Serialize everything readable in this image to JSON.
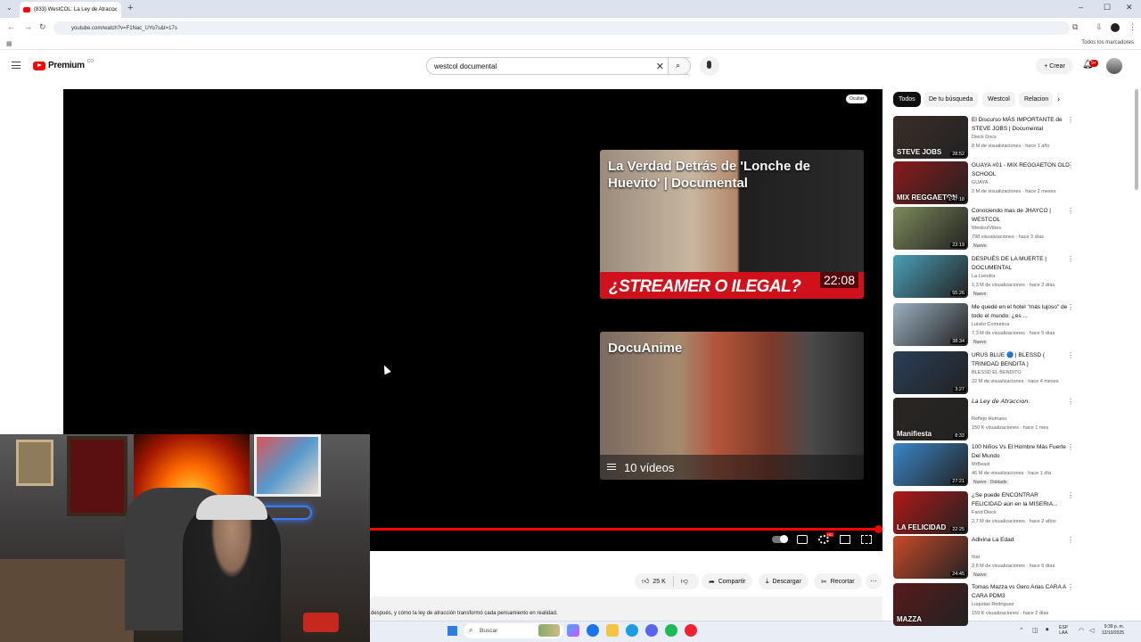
{
  "browser": {
    "tab_title": "(833) WestCOL: La Ley de Atracc",
    "url": "youtube.com/watch?v=F1Nac_UYo7s&t=17s",
    "bookmarks_folder": "Todos los marcadores"
  },
  "header": {
    "logo_word": "Premium",
    "logo_country": "CO",
    "search_value": "westcol documental",
    "create_label": "Crear",
    "notif_count": "9+"
  },
  "player": {
    "hide_label": "Ocultar",
    "progress": 0.995,
    "endcard1": {
      "title": "La Verdad Detrás de 'Lonche de Huevito' | Documental",
      "banner": "¿STREAMER O ILEGAL?",
      "duration": "22:08"
    },
    "endcard2": {
      "title": "DocuAnime",
      "count": "10 vídeos"
    }
  },
  "actions": {
    "likes": "25 K",
    "share": "Compartir",
    "download": "Descargar",
    "clip": "Recortar"
  },
  "description_snippet": "después, y cómo la ley de atracción transformó cada pensamiento en realidad.",
  "chips": [
    "Todos",
    "De tu búsqueda",
    "Westcol",
    "Relacion"
  ],
  "recommendations": [
    {
      "title": "El Discurso MÁS IMPORTANTE de STEVE JOBS | Documental",
      "channel": "Dieck Docs",
      "meta": "8 M de visualizaciones · hace 1 año",
      "duration": "28:52",
      "badge": "",
      "thumb_text": "STEVE JOBS",
      "color": "#3a2e28"
    },
    {
      "title": "GUAYA #01 - MIX REGGAETON OLD SCHOOL",
      "channel": "GUAYA",
      "meta": "2 M de visualizaciones · hace 2 meses",
      "duration": "1:47:18",
      "badge": "",
      "thumb_text": "MIX REGGAETON",
      "color": "#8a1a1a"
    },
    {
      "title": "Conociendo mas de JHAYCO | WESTCOL",
      "channel": "WestcolVibes",
      "meta": "798 visualizaciones · hace 3 días",
      "duration": "23:19",
      "badge": "Nuevo",
      "thumb_text": "",
      "color": "#7d8a5a"
    },
    {
      "title": "DESPUÉS DE LA MUERTE | DOCUMENTAL",
      "channel": "La Lìendra",
      "meta": "1,3 M de visualizaciones · hace 2 días",
      "duration": "55:26",
      "badge": "Nuevo",
      "thumb_text": "",
      "color": "#4aa0b8"
    },
    {
      "title": "Me quedé en el hotel \"más lujoso\" de todo el mundo: ¿es ...",
      "channel": "Luisito Comunica",
      "meta": "7,3 M de visualizaciones · hace 5 días",
      "duration": "38:34",
      "badge": "Nuevo",
      "thumb_text": "",
      "color": "#9ab0c0"
    },
    {
      "title": "URUS BLUE 🔵 | BLESSD ( TRINIDAD BENDITA )",
      "channel": "BLESSD EL BENDITO",
      "meta": "22 M de visualizaciones · hace 4 meses",
      "duration": "3:27",
      "badge": "",
      "thumb_text": "",
      "color": "#2a3e58"
    },
    {
      "title": "𝘓𝘢 𝘓𝘦𝘺 𝘥𝘦 𝘈𝘵𝘳𝘢𝘤𝘤𝘪𝘰𝘯.",
      "channel": "Reflejo Humano",
      "meta": "150 K visualizaciones · hace 1 mes",
      "duration": "8:33",
      "badge": "",
      "thumb_text": "Manifiesta",
      "color": "#2a2622"
    },
    {
      "title": "100 Niños Vs El Hombre Más Fuerte Del Mundo",
      "channel": "MrBeast",
      "meta": "46 M de visualizaciones · hace 1 día",
      "duration": "27:21",
      "badge": "Nuevo · Doblado",
      "thumb_text": "",
      "color": "#3a86c8"
    },
    {
      "title": "¿Se puede ENCONTRAR FELICIDAD aún en la MISERIA...",
      "channel": "Farid Dieck",
      "meta": "2,7 M de visualizaciones · hace 2 años",
      "duration": "22:25",
      "badge": "",
      "thumb_text": "LA FELICIDAD",
      "color": "#b01818"
    },
    {
      "title": "Adivina La Edad",
      "channel": "Ibai",
      "meta": "2,8 M de visualizaciones · hace 6 días",
      "duration": "24:45",
      "badge": "Nuevo",
      "thumb_text": "",
      "color": "#c84a2a"
    },
    {
      "title": "Tomas Mazza vs Gero Arias CARA A CARA PDM3",
      "channel": "Luquitas Rodriguez",
      "meta": "159 K visualizaciones · hace 2 días",
      "duration": "",
      "badge": "",
      "thumb_text": "MAZZA",
      "color": "#5a1a1a"
    }
  ],
  "taskbar": {
    "search_placeholder": "Buscar",
    "lang_top": "ESP",
    "lang_bottom": "LAA",
    "time": "9:39 p. m.",
    "date": "12/10/2025"
  }
}
